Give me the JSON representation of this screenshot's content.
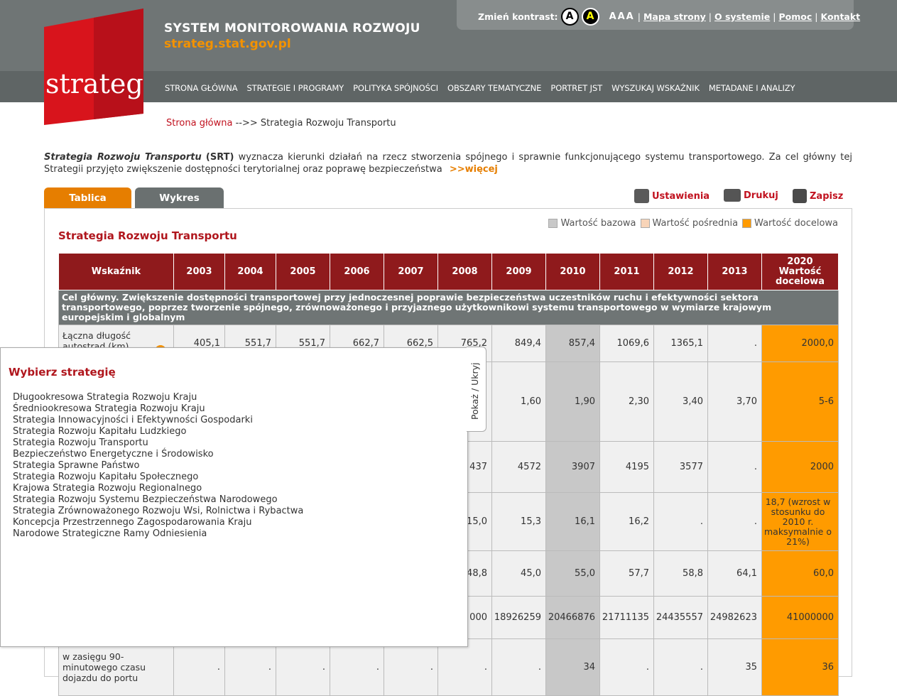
{
  "header": {
    "site_title": "SYSTEM MONITOROWANIA ROZWOJU",
    "site_url": "strateg.stat.gov.pl",
    "logo_text": "strateg",
    "contrast_label": "Zmień kontrast:",
    "contrast_a1": "A",
    "contrast_a2": "A",
    "font_sizes": "AAA",
    "links": [
      "Mapa strony",
      "O systemie",
      "Pomoc",
      "Kontakt"
    ],
    "brand_red": "#c1121f",
    "accent_orange": "#f39200"
  },
  "nav": [
    "STRONA GŁÓWNA",
    "STRATEGIE I PROGRAMY",
    "POLITYKA SPÓJNOŚCI",
    "OBSZARY TEMATYCZNE",
    "PORTRET JST",
    "WYSZUKAJ WSKAŹNIK",
    "METADANE I ANALIZY"
  ],
  "breadcrumb": {
    "home": "Strona główna",
    "sep": "-->>",
    "current": "Strategia Rozwoju Transportu"
  },
  "intro": {
    "strong": "Strategia Rozwoju Transportu",
    "abbr": "(SRT)",
    "text": "wyznacza kierunki działań na rzecz stworzenia spójnego i  sprawnie funkcjonującego systemu transportowego. Za cel główny tej Strategii przyjęto zwiększenie dostępności terytorialnej oraz poprawę bezpieczeństwa",
    "more": ">>więcej"
  },
  "tabs": [
    "Tablica",
    "Wykres"
  ],
  "actions": [
    "Ustawienia",
    "Drukuj",
    "Zapisz"
  ],
  "legend": [
    "Wartość bazowa",
    "Wartość pośrednia",
    "Wartość docelowa"
  ],
  "panel_title": "Strategia Rozwoju Transportu",
  "table": {
    "headers": [
      "Wskaźnik",
      "2003",
      "2004",
      "2005",
      "2006",
      "2007",
      "2008",
      "2009",
      "2010",
      "2011",
      "2012",
      "2013",
      "2020 Wartość docelowa"
    ],
    "goal": "Cel główny. Zwiększenie dostępności transportowej przy jednoczesnej poprawie bezpieczeństwa uczestników ruchu i efektywności sektora transportowego, poprzez tworzenie spójnego, zrównoważonego i przyjaznego użytkownikowi systemu transportowego w wymiarze krajowym europejskim i globalnym",
    "rows": [
      {
        "name": "Łączna długość autostrad (km)",
        "vals": [
          "405,1",
          "551,7",
          "551,7",
          "662,7",
          "662,5",
          "765,2",
          "849,4",
          "857,4",
          "1069,6",
          "1365,1",
          ".",
          "2000,0"
        ]
      },
      {
        "name": "",
        "vals": [
          "",
          "",
          "",
          "",
          "",
          "",
          "1,60",
          "1,90",
          "2,30",
          "3,40",
          "3,70",
          "5-6"
        ]
      },
      {
        "name": "",
        "vals": [
          "",
          "",
          "",
          "",
          "",
          "437",
          "4572",
          "3907",
          "4195",
          "3577",
          ".",
          "2000"
        ]
      },
      {
        "name": "",
        "vals": [
          "",
          "",
          "",
          "",
          "",
          "15,0",
          "15,3",
          "16,1",
          "16,2",
          ".",
          ".",
          "18,7 (wzrost w stosunku do 2010 r. maksymalnie o 21%)"
        ]
      },
      {
        "name": "",
        "vals": [
          "",
          "",
          "",
          "",
          "",
          "48,8",
          "45,0",
          "55,0",
          "57,7",
          "58,8",
          "64,1",
          "60,0"
        ]
      },
      {
        "name": "",
        "vals": [
          "",
          "",
          "",
          "",
          "",
          "000",
          "18926259",
          "20466876",
          "21711135",
          "24435557",
          "24982623",
          "41000000"
        ]
      },
      {
        "name": "w zasięgu 90-minutowego czasu dojazdu do portu",
        "vals": [
          ".",
          ".",
          ".",
          ".",
          ".",
          ".",
          ".",
          "34",
          ".",
          ".",
          "35",
          "36"
        ]
      }
    ]
  },
  "strategy_panel": {
    "title": "Wybierz strategię",
    "toggle": "Pokaż / Ukryj",
    "items": [
      "Długookresowa Strategia Rozwoju Kraju",
      "Średniookresowa Strategia Rozwoju Kraju",
      "Strategia Innowacyjności i Efektywności Gospodarki",
      "Strategia Rozwoju Kapitału Ludzkiego",
      "Strategia Rozwoju Transportu",
      "Bezpieczeństwo Energetyczne i Środowisko",
      "Strategia Sprawne Państwo",
      "Strategia Rozwoju Kapitału Społecznego",
      "Krajowa Strategia Rozwoju Regionalnego",
      "Strategia Rozwoju Systemu Bezpieczeństwa Narodowego",
      "Strategia Zrównoważonego Rozwoju Wsi, Rolnictwa i Rybactwa",
      "Koncepcja Przestrzennego Zagospodarowania Kraju",
      "Narodowe Strategiczne Ramy Odniesienia"
    ]
  }
}
